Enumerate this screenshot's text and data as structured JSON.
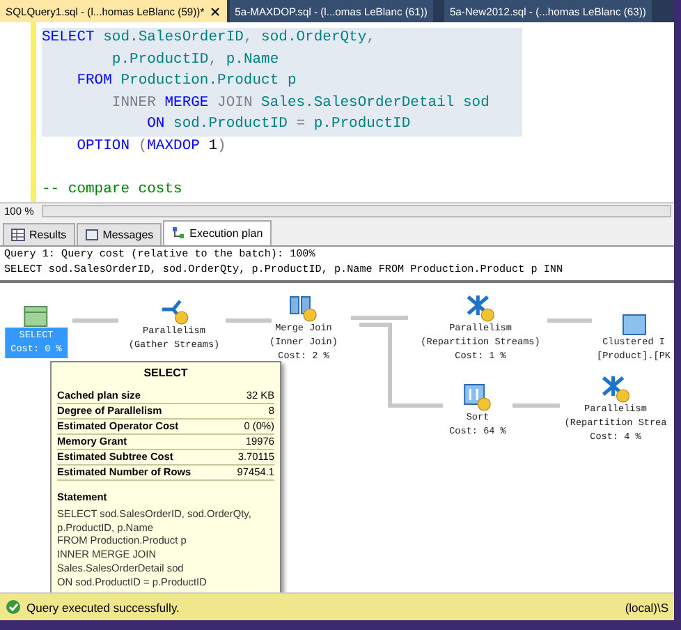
{
  "doc_tabs": [
    {
      "label": "SQLQuery1.sql - (l...homas LeBlanc (59))*",
      "selected": true
    },
    {
      "label": "5a-MAXDOP.sql - (l...omas LeBlanc (61))",
      "selected": false
    },
    {
      "label": "5a-New2012.sql - (...homas LeBlanc (63))",
      "selected": false
    }
  ],
  "editor": {
    "lines": [
      {
        "selected": true,
        "tokens": [
          {
            "t": "SELECT",
            "kind": "kw"
          },
          {
            "t": " sod.SalesOrderID",
            "kind": "id"
          },
          {
            "t": ",",
            "kind": "op"
          },
          {
            "t": " sod.OrderQty",
            "kind": "id"
          },
          {
            "t": ",",
            "kind": "op"
          }
        ]
      },
      {
        "selected": true,
        "tokens": [
          {
            "t": "        p.ProductID",
            "kind": "id"
          },
          {
            "t": ",",
            "kind": "op"
          },
          {
            "t": " p.Name ",
            "kind": "id"
          }
        ]
      },
      {
        "selected": true,
        "tokens": [
          {
            "t": "    FROM",
            "kind": "kw"
          },
          {
            "t": " Production.Product p",
            "kind": "id"
          }
        ]
      },
      {
        "selected": true,
        "tokens": [
          {
            "t": "        INNER",
            "kind": "op"
          },
          {
            "t": " MERGE",
            "kind": "kw"
          },
          {
            "t": " JOIN",
            "kind": "op"
          },
          {
            "t": " Sales.SalesOrderDetail sod",
            "kind": "id"
          }
        ]
      },
      {
        "selected": true,
        "tokens": [
          {
            "t": "            ON",
            "kind": "kw"
          },
          {
            "t": " sod.ProductID ",
            "kind": "id"
          },
          {
            "t": "=",
            "kind": "op"
          },
          {
            "t": " p.ProductID ",
            "kind": "id"
          }
        ]
      },
      {
        "selected": false,
        "tokens": [
          {
            "t": "    OPTION",
            "kind": "kw"
          },
          {
            "t": " (",
            "kind": "op"
          },
          {
            "t": "MAXDOP",
            "kind": "kw"
          },
          {
            "t": " 1",
            "kind": "num"
          },
          {
            "t": ")",
            "kind": "op"
          }
        ]
      },
      {
        "selected": false
      },
      {
        "selected": false,
        "tokens": [
          {
            "t": "-- compare costs",
            "kind": "comment"
          }
        ]
      }
    ],
    "zoom": "100 %"
  },
  "result_tabs": [
    {
      "label": "Results",
      "kind": "grid",
      "selected": false
    },
    {
      "label": "Messages",
      "kind": "messages",
      "selected": false
    },
    {
      "label": "Execution plan",
      "kind": "plan",
      "selected": true
    }
  ],
  "plan": {
    "header": [
      "Query 1: Query cost (relative to the batch): 100%",
      "SELECT sod.SalesOrderID, sod.OrderQty, p.ProductID, p.Name FROM Production.Product p INN"
    ],
    "nodes": [
      {
        "kind": "select",
        "lines": [
          "SELECT",
          "Cost: 0 %"
        ],
        "selected": true
      },
      {
        "kind": "gather",
        "lines": [
          "Parallelism",
          "(Gather Streams)"
        ],
        "selected": false
      },
      {
        "kind": "merge",
        "lines": [
          "Merge Join",
          "(Inner Join)",
          "Cost: 2 %"
        ],
        "selected": false
      },
      {
        "kind": "repartition",
        "lines": [
          "Parallelism",
          "(Repartition Streams)",
          "Cost: 1 %"
        ],
        "selected": false
      },
      {
        "kind": "scan",
        "lines": [
          "Clustered I",
          "[Product].[PK"
        ],
        "selected": false
      },
      {
        "kind": "sort",
        "lines": [
          "Sort",
          "Cost: 64 %"
        ],
        "selected": false
      },
      {
        "kind": "repartition",
        "lines": [
          "Parallelism",
          "(Repartition Strea",
          "Cost: 4 %"
        ],
        "selected": false
      }
    ]
  },
  "tooltip": {
    "title": "SELECT",
    "rows": [
      {
        "label": "Cached plan size",
        "value": "32 KB"
      },
      {
        "label": "Degree of Parallelism",
        "value": "8"
      },
      {
        "label": "Estimated Operator Cost",
        "value": "0 (0%)"
      },
      {
        "label": "Memory Grant",
        "value": "19976"
      },
      {
        "label": "Estimated Subtree Cost",
        "value": "3.70115"
      },
      {
        "label": "Estimated Number of Rows",
        "value": "97454.1"
      }
    ],
    "statement_heading": "Statement",
    "statement": [
      "SELECT sod.SalesOrderID, sod.OrderQty,",
      "p.ProductID, p.Name",
      "FROM Production.Product p",
      "INNER MERGE JOIN",
      "Sales.SalesOrderDetail sod",
      "ON sod.ProductID = p.ProductID"
    ]
  },
  "status_bar": {
    "message": "Query executed successfully.",
    "server": "(local)\\S"
  }
}
